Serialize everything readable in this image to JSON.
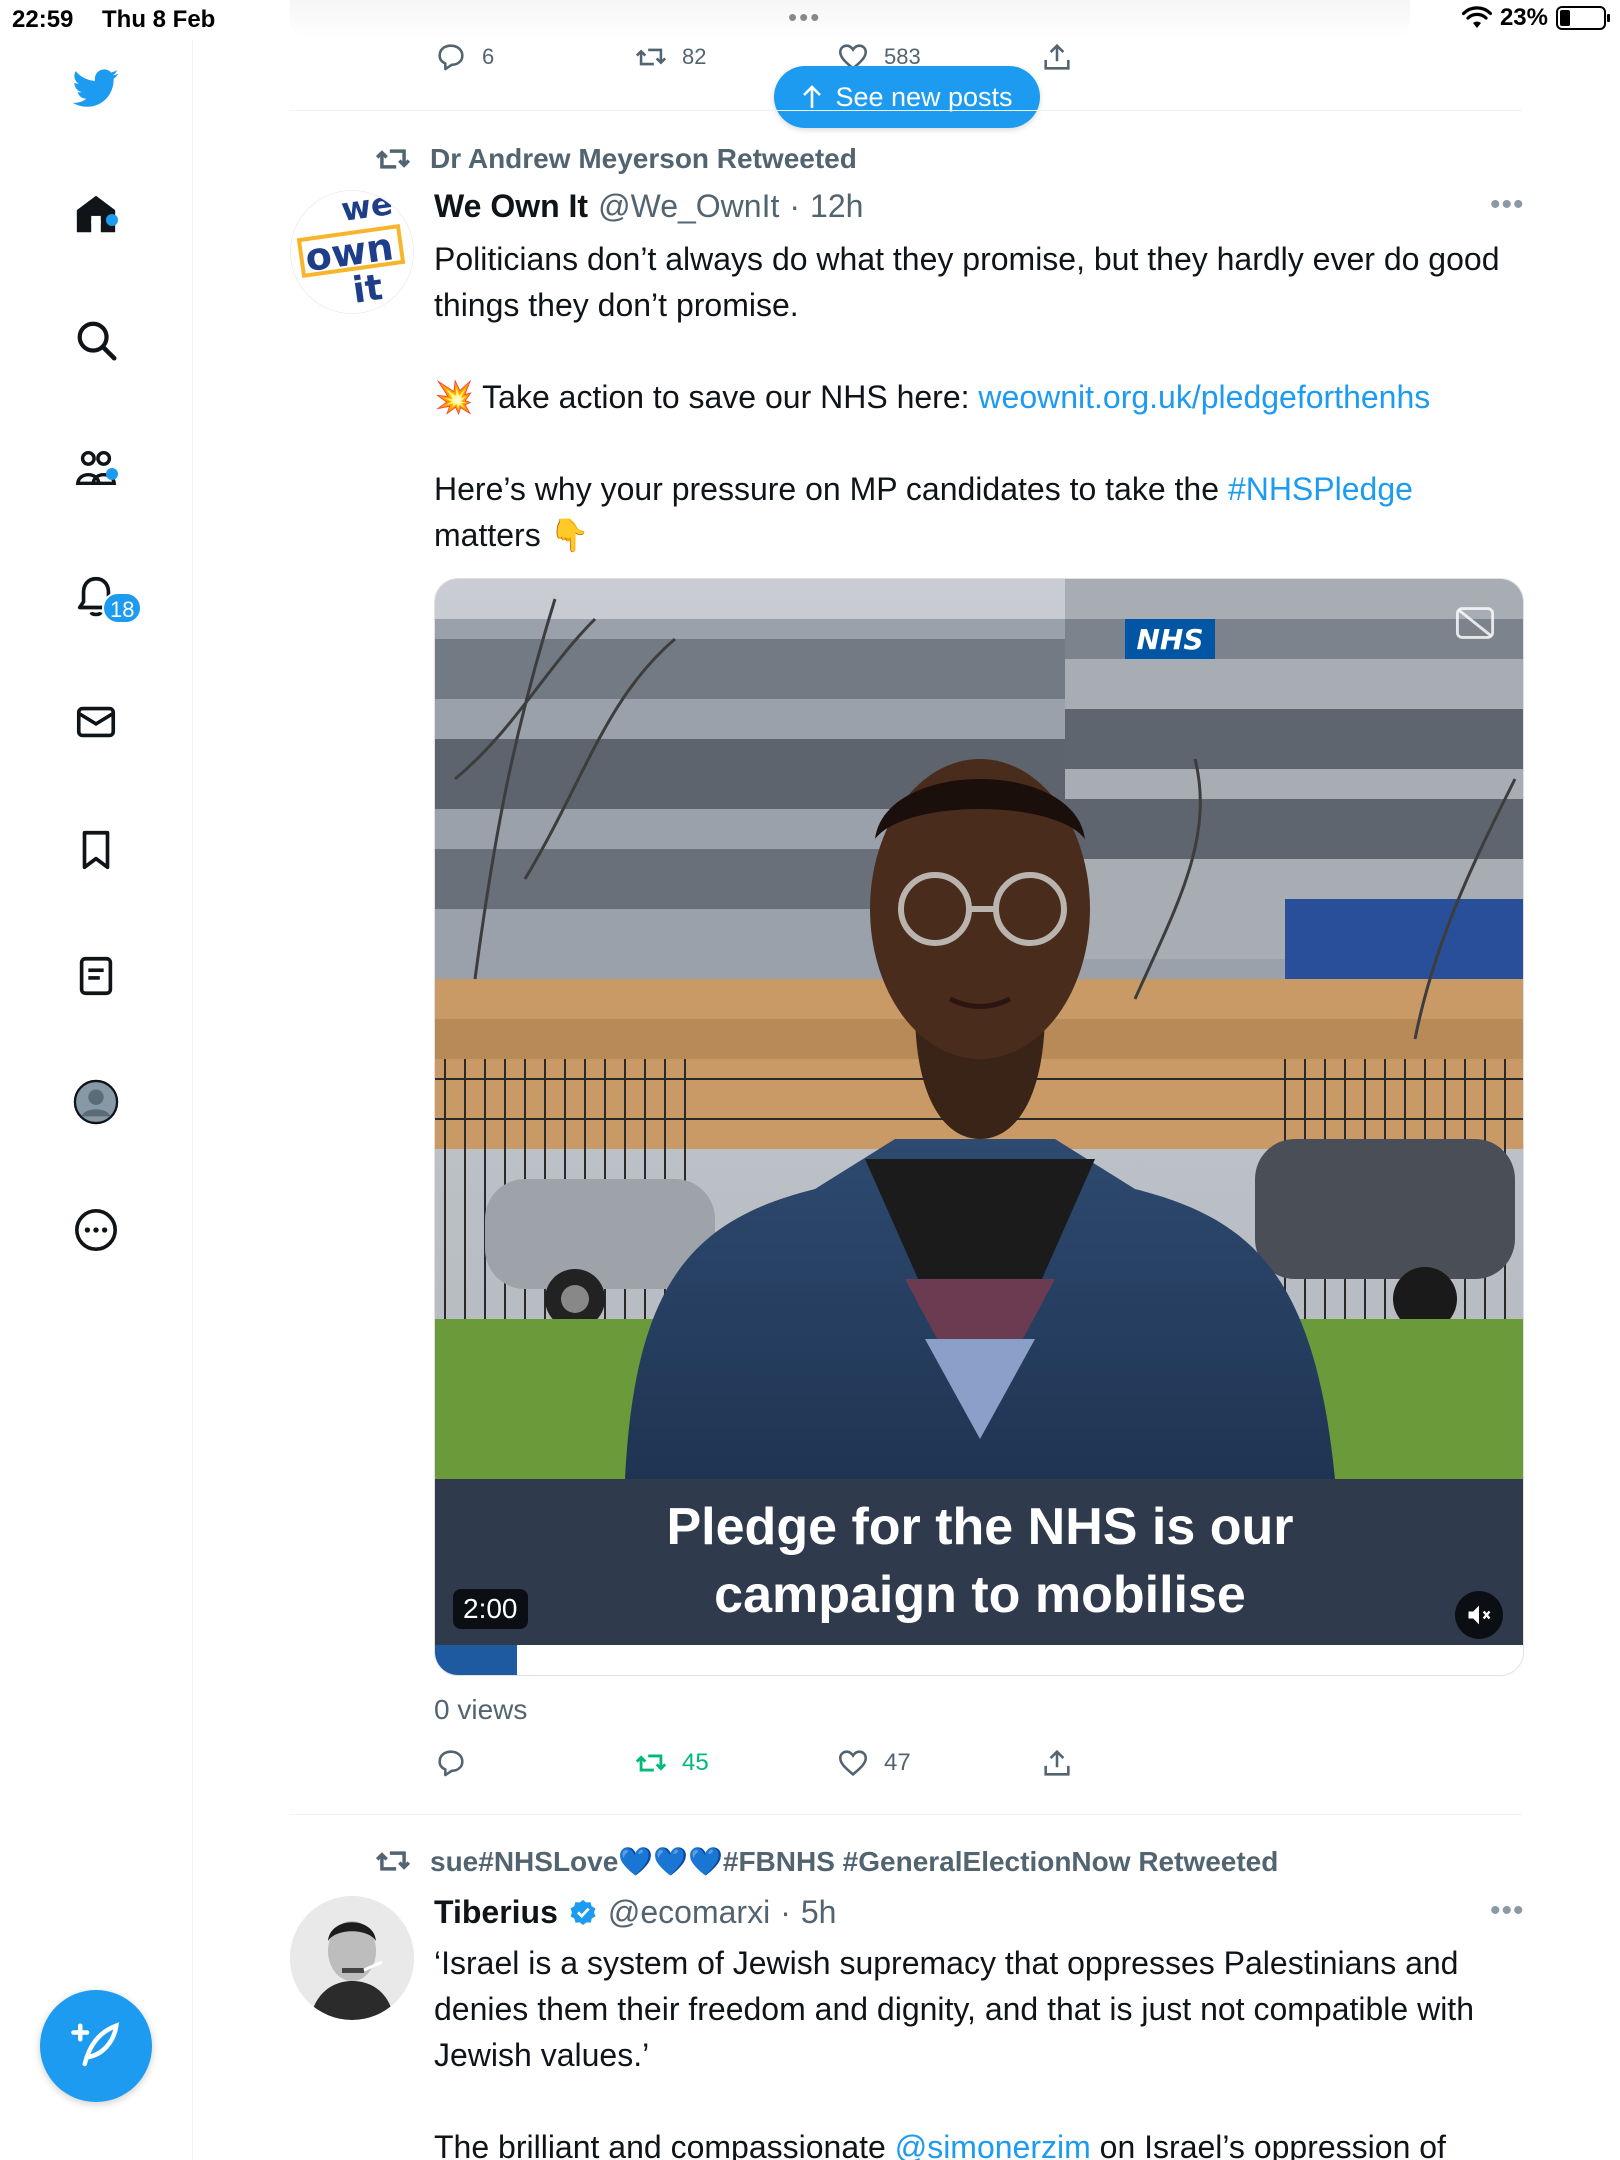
{
  "status_bar": {
    "time": "22:59",
    "date": "Thu 8 Feb",
    "battery": "23%"
  },
  "top_actions": {
    "reply": "6",
    "retweet": "82",
    "like": "583"
  },
  "see_new_posts": "See new posts",
  "colors": {
    "accent": "#1d9bf0",
    "retweet_active": "#00ba7c",
    "text": "#0f1419",
    "muted": "#536471"
  },
  "sidebar": {
    "icons": [
      "twitter-bird-icon",
      "home-icon",
      "search-icon",
      "communities-icon",
      "notifications-icon",
      "messages-icon",
      "bookmarks-icon",
      "lists-icon",
      "profile-icon",
      "more-icon"
    ],
    "notification_count": "18",
    "compose_icon": "feather-plus-icon"
  },
  "tweets": [
    {
      "retweeted_by": "Dr Andrew Meyerson Retweeted",
      "name": "We Own It",
      "handle": "@We_OwnIt",
      "time": "12h",
      "avatar_text": [
        "we",
        "own",
        "it"
      ],
      "text_line1": "Politicians don’t always do what they promise, but they hardly ever do good things they don’t promise.",
      "text_action_emoji": "💥",
      "text_action": " Take action to save our NHS here: ",
      "text_link": "weownit.org.uk/pledgeforthenhs",
      "text_pressure": "Here’s why your pressure on MP candidates to take the ",
      "text_hashtag": "#NHSPledge",
      "text_matters": " matters ",
      "text_point_emoji": "👇",
      "media": {
        "sign": "NHS",
        "caption_line1": "Pledge for the NHS is our",
        "caption_line2": "campaign to mobilise",
        "duration": "2:00",
        "progress": 0.075
      },
      "views": "0 views",
      "reply_count": "",
      "retweet_count": "45",
      "like_count": "47"
    },
    {
      "retweeted_by": "sue#NHSLove💙💙💙#FBNHS #GeneralElectionNow Retweeted",
      "name": "Tiberius",
      "verified": true,
      "handle": "@ecomarxi",
      "time": "5h",
      "text_line1": "‘Israel is a system of Jewish supremacy that oppresses Palestinians and denies them their freedom and dignity, and that is just not compatible with Jewish values.’",
      "text_line2_start": "The brilliant and compassionate ",
      "text_mention": "@simonerzim",
      "text_line2_end": " on Israel’s oppression of"
    }
  ]
}
